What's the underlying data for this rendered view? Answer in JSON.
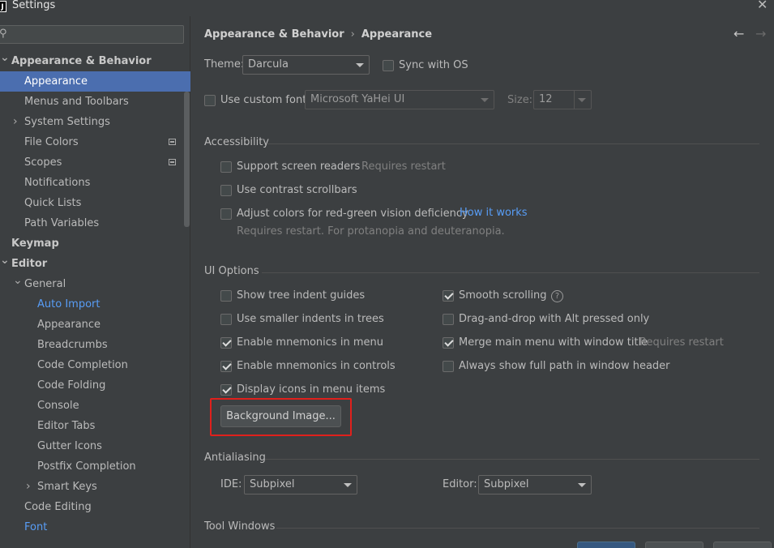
{
  "window": {
    "title": "Settings",
    "app_icon_letter": "J",
    "close_glyph": "✕"
  },
  "search": {
    "value": "",
    "placeholder": ""
  },
  "sidebar": {
    "items": [
      {
        "label": "Appearance & Behavior",
        "level": 0,
        "expanded": true,
        "bold": true
      },
      {
        "label": "Appearance",
        "level": 1,
        "selected": true
      },
      {
        "label": "Menus and Toolbars",
        "level": 1
      },
      {
        "label": "System Settings",
        "level": 1,
        "collapsed": true
      },
      {
        "label": "File Colors",
        "level": 1,
        "badge": true
      },
      {
        "label": "Scopes",
        "level": 1,
        "badge": true
      },
      {
        "label": "Notifications",
        "level": 1
      },
      {
        "label": "Quick Lists",
        "level": 1
      },
      {
        "label": "Path Variables",
        "level": 1
      },
      {
        "label": "Keymap",
        "level": 0,
        "bold": true
      },
      {
        "label": "Editor",
        "level": 0,
        "expanded": true,
        "bold": true
      },
      {
        "label": "General",
        "level": 1,
        "expanded": true
      },
      {
        "label": "Auto Import",
        "level": 2,
        "link": true
      },
      {
        "label": "Appearance",
        "level": 2
      },
      {
        "label": "Breadcrumbs",
        "level": 2
      },
      {
        "label": "Code Completion",
        "level": 2
      },
      {
        "label": "Code Folding",
        "level": 2
      },
      {
        "label": "Console",
        "level": 2
      },
      {
        "label": "Editor Tabs",
        "level": 2
      },
      {
        "label": "Gutter Icons",
        "level": 2
      },
      {
        "label": "Postfix Completion",
        "level": 2
      },
      {
        "label": "Smart Keys",
        "level": 2,
        "collapsed": true
      },
      {
        "label": "Code Editing",
        "level": 1
      },
      {
        "label": "Font",
        "level": 1,
        "link": true
      }
    ]
  },
  "breadcrumb": {
    "parent": "Appearance & Behavior",
    "separator": "›",
    "current": "Appearance"
  },
  "nav": {
    "back": "←",
    "forward": "→"
  },
  "theme": {
    "label": "Theme:",
    "value": "Darcula",
    "sync_label": "Sync with OS",
    "sync_checked": false
  },
  "custom_font": {
    "label": "Use custom font:",
    "checked": false,
    "font_value": "Microsoft YaHei UI",
    "size_label": "Size:",
    "size_value": "12"
  },
  "accessibility": {
    "title": "Accessibility",
    "screen_readers": {
      "label": "Support screen readers",
      "note": "Requires restart",
      "checked": false
    },
    "contrast_scrollbars": {
      "label": "Use contrast scrollbars",
      "checked": false
    },
    "red_green": {
      "label": "Adjust colors for red-green vision deficiency",
      "link": "How it works",
      "note": "Requires restart. For protanopia and deuteranopia.",
      "checked": false
    }
  },
  "ui_options": {
    "title": "UI Options",
    "left": [
      {
        "label": "Show tree indent guides",
        "checked": false
      },
      {
        "label": "Use smaller indents in trees",
        "checked": false
      },
      {
        "label": "Enable mnemonics in menu",
        "checked": true
      },
      {
        "label": "Enable mnemonics in controls",
        "checked": true
      },
      {
        "label": "Display icons in menu items",
        "checked": true
      }
    ],
    "right": [
      {
        "label": "Smooth scrolling",
        "checked": true,
        "help": "?"
      },
      {
        "label": "Drag-and-drop with Alt pressed only",
        "checked": false
      },
      {
        "label": "Merge main menu with window title",
        "checked": true,
        "note": "Requires restart"
      },
      {
        "label": "Always show full path in window header",
        "checked": false
      }
    ],
    "background_button": "Background Image..."
  },
  "antialiasing": {
    "title": "Antialiasing",
    "ide_label": "IDE:",
    "ide_value": "Subpixel",
    "editor_label": "Editor:",
    "editor_value": "Subpixel"
  },
  "tool_windows": {
    "title": "Tool Windows"
  },
  "colors": {
    "accent": "#4b6eaf",
    "link": "#589df6",
    "highlight": "#e0201c",
    "background": "#3c3f41"
  }
}
